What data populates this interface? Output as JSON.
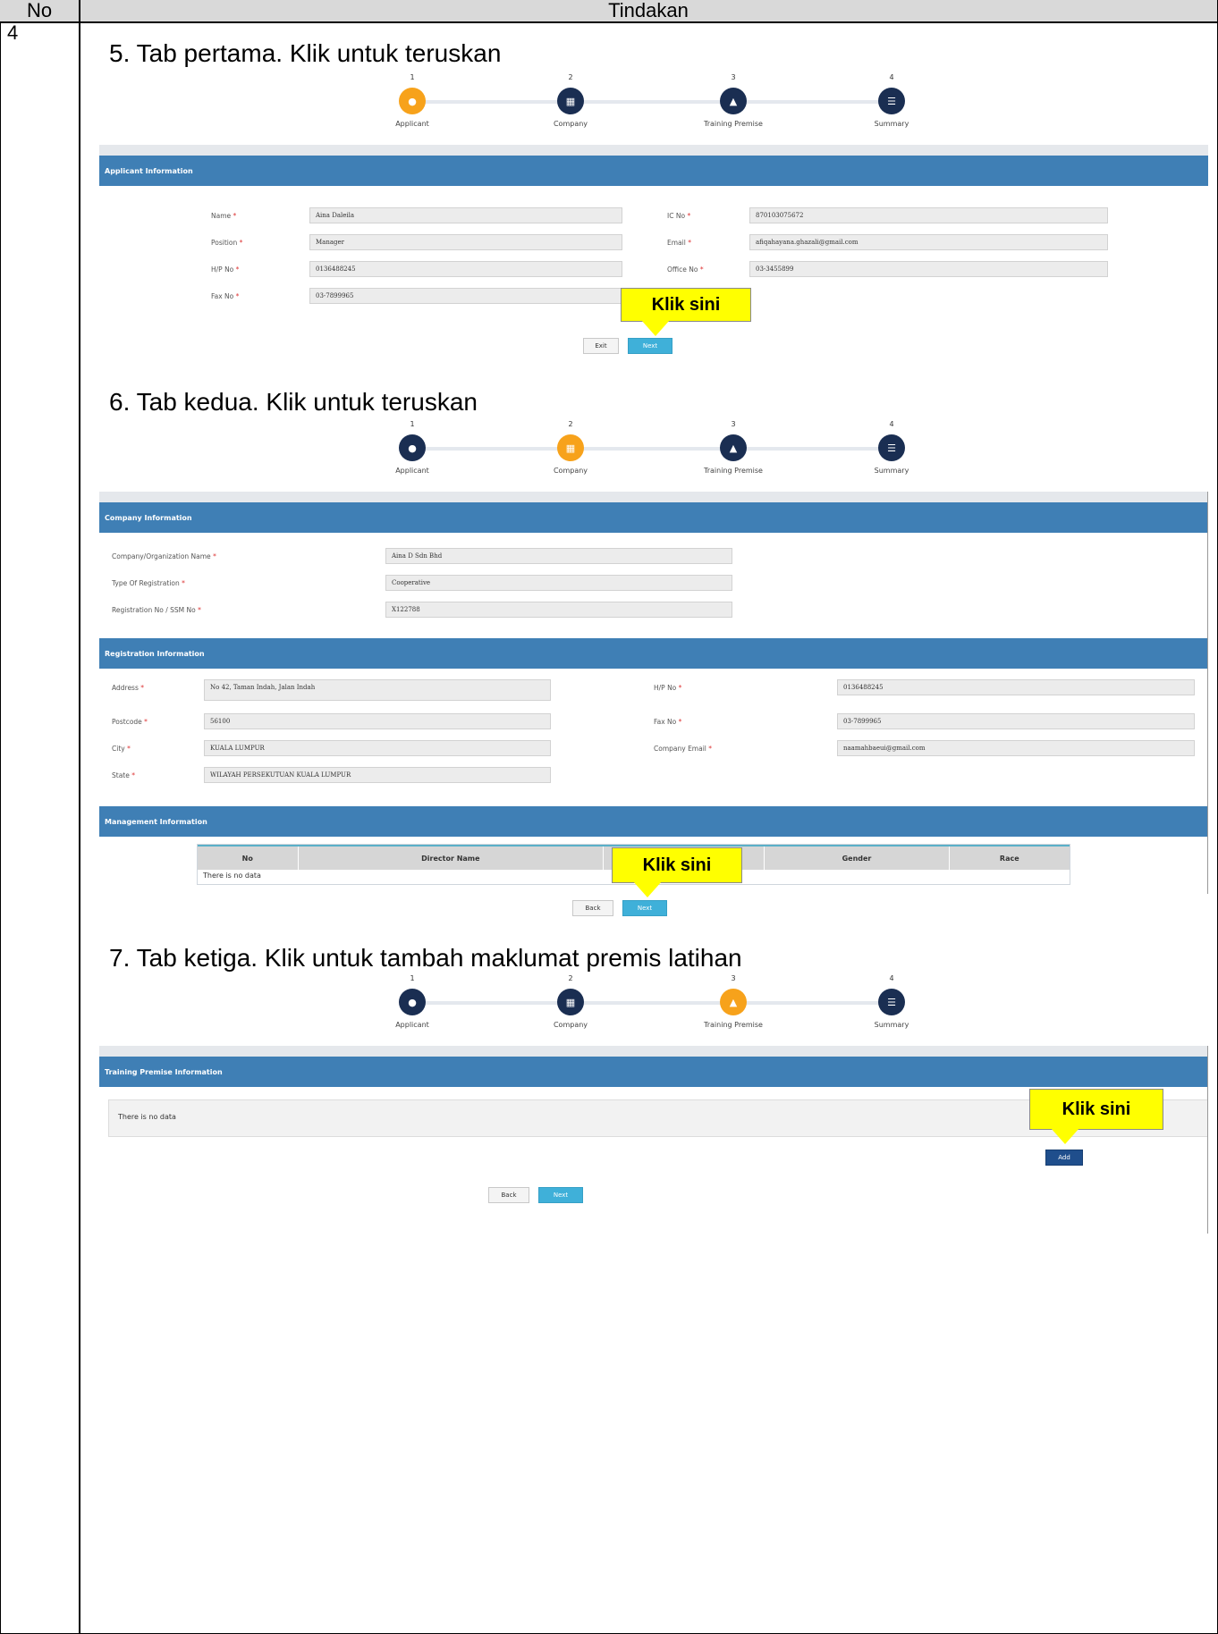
{
  "document": {
    "header": {
      "no": "No",
      "tindakan": "Tindakan"
    },
    "row_no": "4",
    "steps": [
      {
        "title": "5.  Tab pertama. Klik untuk teruskan"
      },
      {
        "title": "6.  Tab kedua. Klik untuk teruskan"
      },
      {
        "title": "7.  Tab ketiga. Klik untuk tambah maklumat premis latihan"
      }
    ],
    "callout": "Klik sini"
  },
  "wizard": {
    "steps": [
      {
        "num": "1",
        "label": "Applicant",
        "icon": "user-icon"
      },
      {
        "num": "2",
        "label": "Company",
        "icon": "building-icon"
      },
      {
        "num": "3",
        "label": "Training Premise",
        "icon": "bank-icon"
      },
      {
        "num": "4",
        "label": "Summary",
        "icon": "list-icon"
      }
    ]
  },
  "applicant": {
    "section_title": "Applicant Information",
    "fields": {
      "name_label": "Name",
      "name_value": "Aina Daleila",
      "ic_label": "IC No",
      "ic_value": "870103075672",
      "position_label": "Position",
      "position_value": "Manager",
      "email_label": "Email",
      "email_value": "afiqahayana.ghazali@gmail.com",
      "hp_label": "H/P No",
      "hp_value": "0136488245",
      "office_label": "Office No",
      "office_value": "03-3455899",
      "fax_label": "Fax No",
      "fax_value": "03-7899965"
    },
    "exit_label": "Exit",
    "next_label": "Next"
  },
  "company": {
    "section_title": "Company Information",
    "org_name_label": "Company/Organization Name",
    "org_name_value": "Aina D Sdn Bhd",
    "reg_type_label": "Type Of Registration",
    "reg_type_value": "Cooperative",
    "reg_no_label": "Registration No / SSM No",
    "reg_no_value": "X122788",
    "registration_title": "Registration Information",
    "address_label": "Address",
    "address_value": "No 42, Taman Indah, Jalan Indah",
    "postcode_label": "Postcode",
    "postcode_value": "56100",
    "city_label": "City",
    "city_value": "KUALA LUMPUR",
    "state_label": "State",
    "state_value": "WILAYAH PERSEKUTUAN KUALA LUMPUR",
    "hp_label": "H/P No",
    "hp_value": "0136488245",
    "fax_label": "Fax No",
    "fax_value": "03-7899965",
    "email_label": "Company Email",
    "email_value": "naamahbaeui@gmail.com",
    "management_title": "Management Information",
    "table_cols": [
      "No",
      "Director Name",
      "",
      "Gender",
      "Race"
    ],
    "no_data": "There is no data",
    "back_label": "Back",
    "next_label": "Next"
  },
  "premise": {
    "section_title": "Training Premise Information",
    "no_data": "There is no data",
    "add_label": "Add",
    "back_label": "Back",
    "next_label": "Next"
  },
  "colors": {
    "active_step": "#f7a21b",
    "done_step": "#1a2e52",
    "section_bar": "#3f7fb5",
    "next_button": "#3fb0d9",
    "callout": "#ffff00"
  }
}
